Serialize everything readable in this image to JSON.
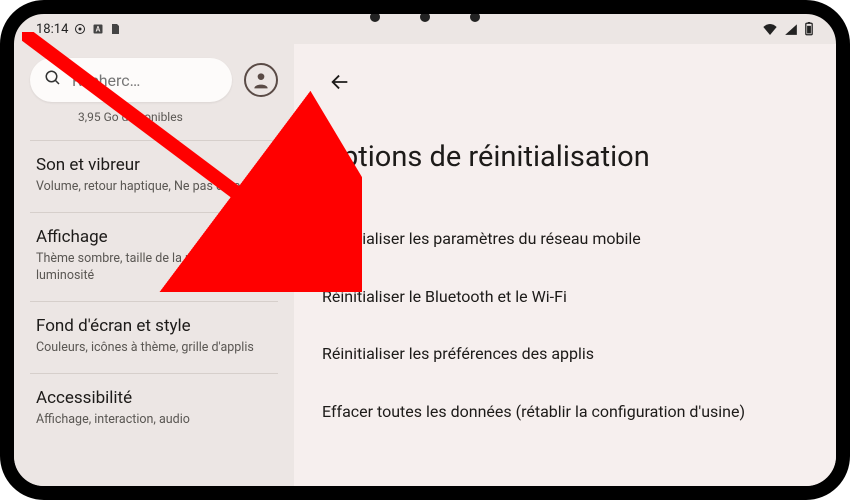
{
  "statusbar": {
    "time": "18:14"
  },
  "sidebar": {
    "search_placeholder": "Recherc…",
    "storage": "3,95 Go disponibles",
    "items": [
      {
        "title": "Son et vibreur",
        "sub": "Volume, retour haptique, Ne pas déranger"
      },
      {
        "title": "Affichage",
        "sub": "Thème sombre, taille de la police, luminosité"
      },
      {
        "title": "Fond d'écran et style",
        "sub": "Couleurs, icônes à thème, grille d'applis"
      },
      {
        "title": "Accessibilité",
        "sub": "Affichage, interaction, audio"
      }
    ]
  },
  "main": {
    "title": "Options de réinitialisation",
    "options": [
      "Réinitialiser les paramètres du réseau mobile",
      "Réinitialiser le Bluetooth et le Wi-Fi",
      "Réinitialiser les préférences des applis",
      "Effacer toutes les données (rétablir la configuration d'usine)"
    ]
  }
}
